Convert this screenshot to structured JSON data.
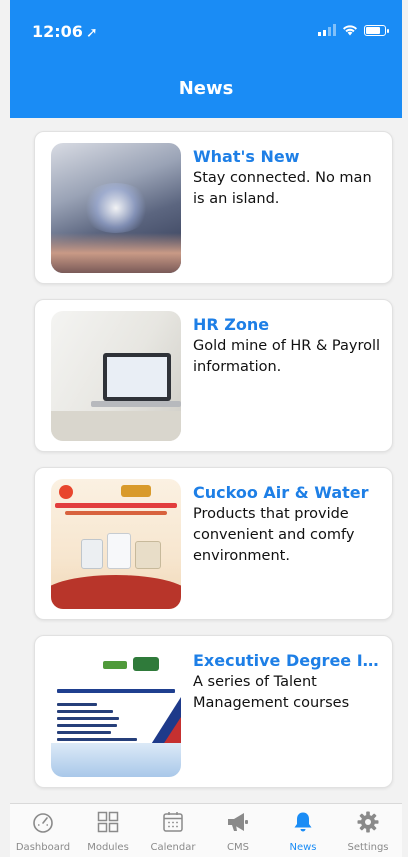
{
  "status_bar": {
    "time": "12:06",
    "location_glyph": "➚"
  },
  "header": {
    "title": "News",
    "background": "#1a8cf5"
  },
  "news_items": [
    {
      "title": "What's New",
      "description": "Stay connected. No man is an island.",
      "image_icon": "tablet-hands-network-image"
    },
    {
      "title": "HR Zone",
      "description": "Gold mine of HR & Payroll information.",
      "image_icon": "laptop-desk-image"
    },
    {
      "title": "Cuckoo Air & Water",
      "description": "Products that provide convenient and comfy environment.",
      "image_icon": "chinese-new-year-promo-image"
    },
    {
      "title": "Executive Degree In Talent Management",
      "description": "A series of Talent Management courses",
      "image_icon": "executive-degree-poster-image"
    }
  ],
  "tab_bar": {
    "active": "News",
    "active_color": "#1a8cf5",
    "tabs": [
      {
        "label": "Dashboard",
        "icon": "speedometer-icon"
      },
      {
        "label": "Modules",
        "icon": "grid-icon"
      },
      {
        "label": "Calendar",
        "icon": "calendar-icon"
      },
      {
        "label": "CMS",
        "icon": "megaphone-icon"
      },
      {
        "label": "News",
        "icon": "bell-icon"
      },
      {
        "label": "Settings",
        "icon": "gear-icon"
      }
    ]
  }
}
